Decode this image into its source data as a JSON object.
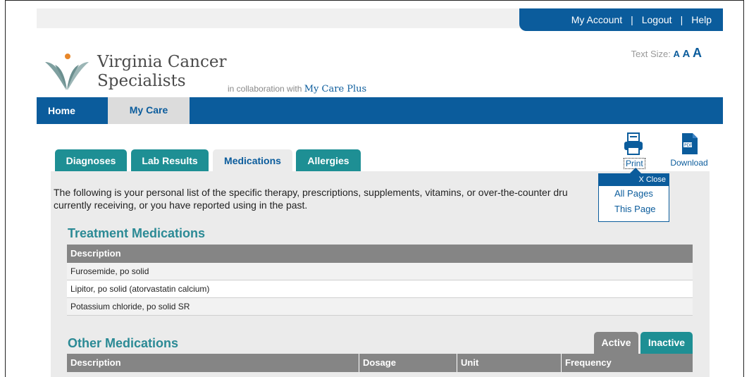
{
  "header": {
    "account_links": [
      "My Account",
      "Logout",
      "Help"
    ],
    "separator": "|",
    "brand_line1": "Virginia Cancer",
    "brand_line2": "Specialists",
    "collab_prefix": "in collaboration with",
    "collab_name": "My Care Plus",
    "text_size_label": "Text Size:",
    "text_size_options": [
      "A",
      "A",
      "A"
    ]
  },
  "nav": {
    "home": "Home",
    "my_care": "My Care"
  },
  "tabs": [
    "Diagnoses",
    "Lab Results",
    "Medications",
    "Allergies"
  ],
  "active_tab": "Medications",
  "tools": {
    "print_label": "Print",
    "download_label": "Download",
    "popup_close": "X Close",
    "popup_items": [
      "All Pages",
      "This Page"
    ]
  },
  "intro_text": "The following is your personal list of the specific therapy, prescriptions, supplements, vitamins, or over-the-counter dru",
  "intro_text2": "currently receiving, or you have reported using in the past.",
  "treatment": {
    "title": "Treatment Medications",
    "header": "Description",
    "rows": [
      "Furosemide, po solid",
      "Lipitor, po solid (atorvastatin calcium)",
      "Potassium chloride, po solid SR"
    ]
  },
  "other": {
    "title": "Other Medications",
    "subtabs": [
      "Active",
      "Inactive"
    ],
    "columns": [
      "Description",
      "Dosage",
      "Unit",
      "Frequency"
    ]
  },
  "colors": {
    "brand_blue": "#0b5c9c",
    "teal": "#1e8f94",
    "heading_teal": "#2b8a95",
    "table_header_gray": "#858585"
  }
}
